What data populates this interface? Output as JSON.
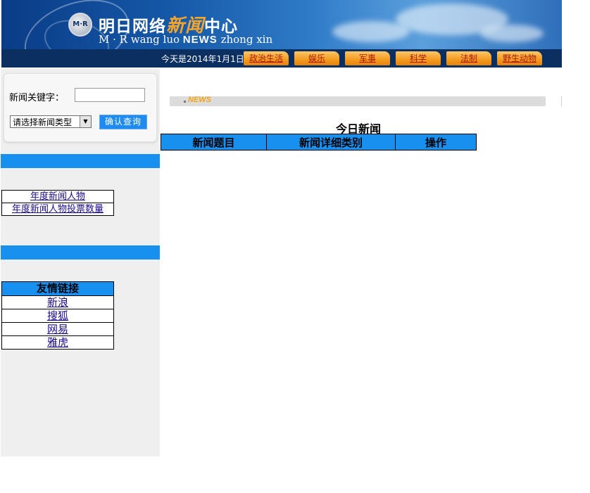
{
  "banner": {
    "logo_text": "M·R",
    "title_a": "明日网络",
    "title_hl": "新闻",
    "title_b": "中心",
    "subtitle_a": "M · R wang luo ",
    "subtitle_news": "NEWS",
    "subtitle_b": " zhong xin"
  },
  "header": {
    "date_text": "今天是2014年1月1日",
    "nav": [
      "政治生活",
      "娱乐",
      "军事",
      "科学",
      "法制",
      "野生动物"
    ]
  },
  "search": {
    "keyword_label": "新闻关键字：",
    "keyword_value": "",
    "type_select_value": "请选择新闻类型",
    "submit_label": "确认查询"
  },
  "person_links": [
    "年度新闻人物",
    "年度新闻人物投票数量"
  ],
  "friend_links": {
    "header": "友情链接",
    "items": [
      "新浪",
      "搜狐",
      "网易",
      "雅虎"
    ]
  },
  "main": {
    "news_badge": "NEWS",
    "today_title": "今日新闻",
    "table_headers": [
      "新闻题目",
      "新闻详细类别",
      "操作"
    ]
  },
  "colors": {
    "accent_blue": "#1890ef",
    "nav_orange": "#f39a1f",
    "nav_text": "#b0150c",
    "sidebar_bg": "#efefef"
  }
}
